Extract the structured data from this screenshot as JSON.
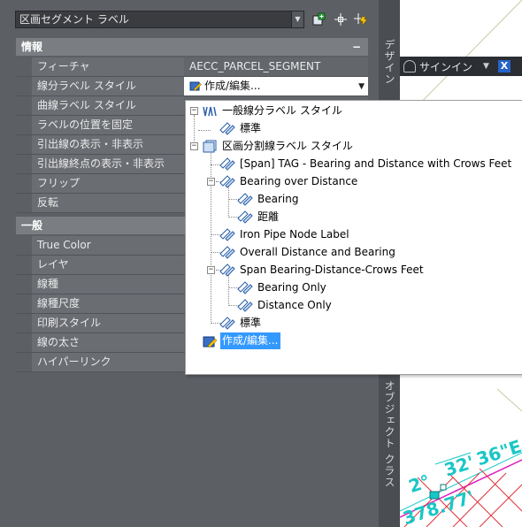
{
  "palette": {
    "style_combo": "区画セグメント ラベル",
    "sections": {
      "info": "情報",
      "general": "一般"
    },
    "info_rows": [
      {
        "name": "フィーチャ",
        "value": "AECC_PARCEL_SEGMENT"
      },
      {
        "name": "線分ラベル スタイル",
        "value": "作成/編集..."
      },
      {
        "name": "曲線ラベル スタイル",
        "value": ""
      },
      {
        "name": "ラベルの位置を固定",
        "value": ""
      },
      {
        "name": "引出線の表示・非表示",
        "value": ""
      },
      {
        "name": "引出線終点の表示・非表示",
        "value": ""
      },
      {
        "name": "フリップ",
        "value": ""
      },
      {
        "name": "反転",
        "value": ""
      }
    ],
    "general_rows": [
      {
        "name": "True Color",
        "value": ""
      },
      {
        "name": "レイヤ",
        "value": ""
      },
      {
        "name": "線種",
        "value": ""
      },
      {
        "name": "線種尺度",
        "value": ""
      },
      {
        "name": "印刷スタイル",
        "value": ""
      },
      {
        "name": "線の太さ",
        "value": ""
      },
      {
        "name": "ハイパーリンク",
        "value": ""
      }
    ]
  },
  "side_tabs": {
    "design": "デザイン",
    "object_class": "オブジェクト クラス"
  },
  "signin": {
    "label": "サインイン",
    "close": "X"
  },
  "tree": {
    "line_label_root": "一般線分ラベル スタイル",
    "line_label_standard": "標準",
    "parcel_root": "区画分割線ラベル スタイル",
    "span_tag": "[Span] TAG - Bearing and Distance with Crows Feet",
    "bearing_over_distance": "Bearing over Distance",
    "bearing": "Bearing",
    "distance_jp": "距離",
    "iron_pipe": "Iron Pipe Node Label",
    "overall": "Overall Distance and Bearing",
    "span_crows": "Span Bearing-Distance-Crows Feet",
    "bearing_only": "Bearing Only",
    "distance_only": "Distance Only",
    "parcel_standard": "標準",
    "create_edit": "作成/編集..."
  },
  "drawing_labels": {
    "angle_a": "2°",
    "angle_b": "32'",
    "angle_c": "36\"E",
    "dist": "378.77'"
  },
  "colors": {
    "palette_bg": "#5c5f64",
    "section_bg": "#7a7d82",
    "selection": "#3399ff",
    "cyan_label": "#19c7c7",
    "red_hatch": "#e0303a",
    "magenta_line": "#e020c0"
  }
}
